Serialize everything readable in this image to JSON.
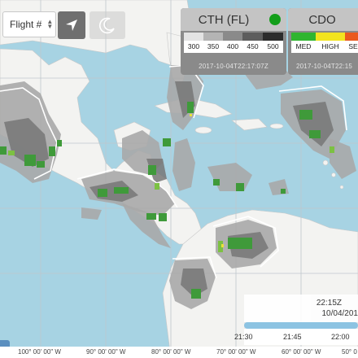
{
  "controls": {
    "flight_label": "Flight #",
    "flight_stepper": "⇳",
    "navigate_icon": "location-arrow-icon",
    "night_icon": "moon-icon"
  },
  "legend_cth": {
    "title": "CTH (FL)",
    "status_color": "#139e1a",
    "levels": [
      {
        "label": "300",
        "color": "#e3e3e3"
      },
      {
        "label": "350",
        "color": "#b4b4b4"
      },
      {
        "label": "400",
        "color": "#8a8a8a"
      },
      {
        "label": "450",
        "color": "#5d5d5d"
      },
      {
        "label": "500",
        "color": "#2c2c2c"
      }
    ],
    "timestamp": "2017-10-04T22:17:07Z"
  },
  "legend_cdo": {
    "title": "CDO",
    "levels": [
      {
        "label": "MED",
        "color": "#2fb52f"
      },
      {
        "label": "HIGH",
        "color": "#f2e41f"
      },
      {
        "label": "SE",
        "color": "#ea5a1e"
      }
    ],
    "timestamp": "2017-10-04T22:15"
  },
  "time": {
    "current_time": "22:15Z",
    "current_date": "10/04/201",
    "progress": 1.0,
    "ticks": [
      "21:30",
      "21:45",
      "22:00"
    ]
  },
  "longitudes": [
    "100° 00' 00\" W",
    "90° 00' 00\" W",
    "80° 00' 00\" W",
    "70° 00' 00\" W",
    "60° 00' 00\" W",
    "50° 0"
  ],
  "colors": {
    "ocean": "#a7d3e3",
    "land": "#f3f3f1",
    "cloud_light": "#a9a9a9",
    "cloud_dark": "#777777",
    "convection": "#3f9a3a"
  }
}
